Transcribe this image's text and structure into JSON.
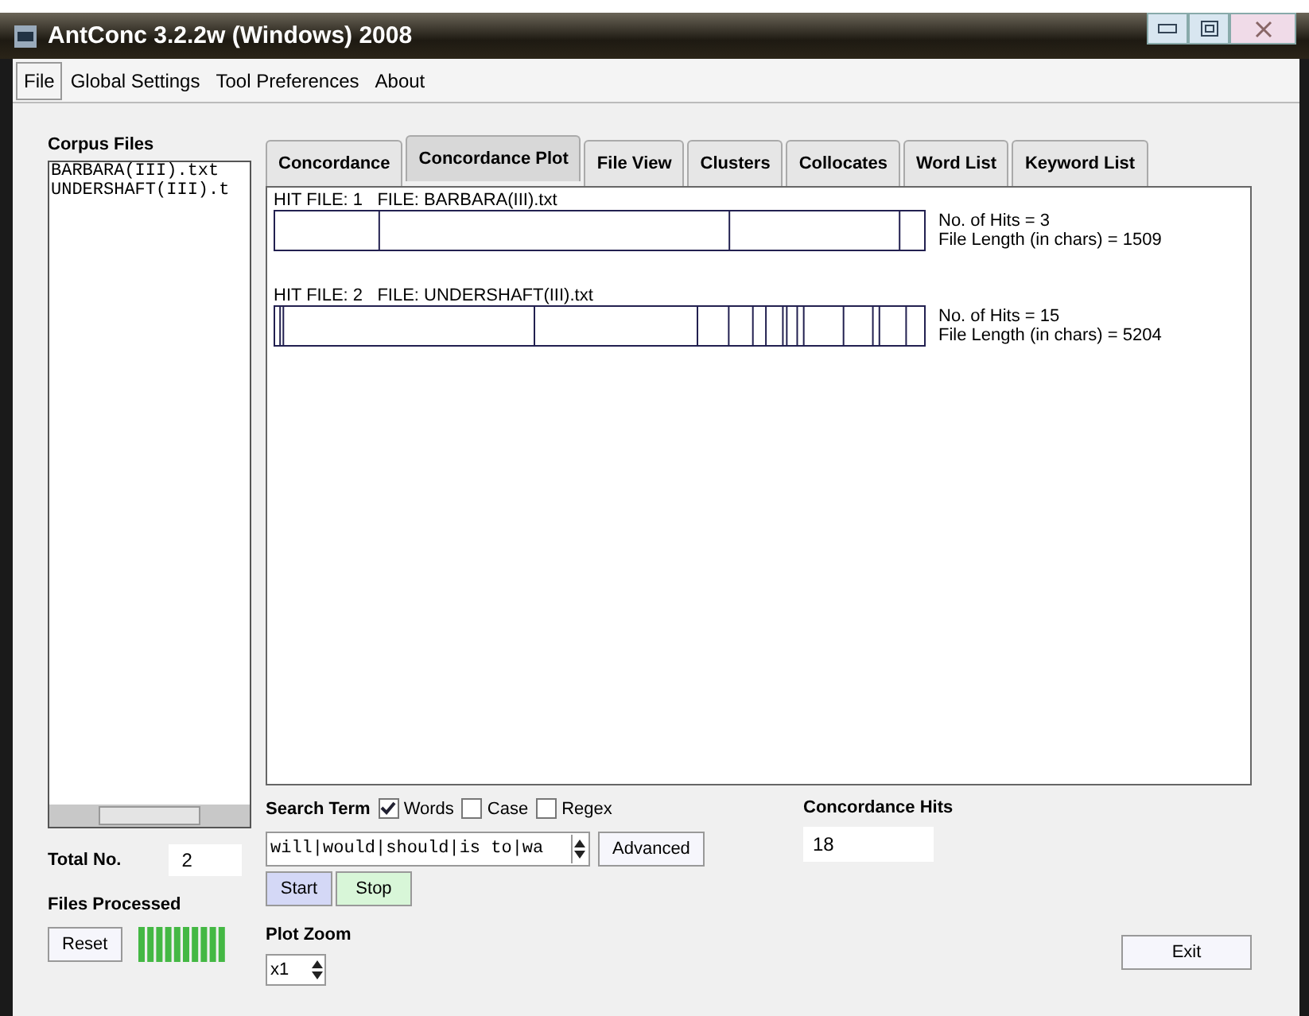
{
  "window": {
    "title": "AntConc 3.2.2w (Windows) 2008"
  },
  "menu": [
    {
      "label": "File",
      "selected": true
    },
    {
      "label": "Global Settings",
      "selected": false
    },
    {
      "label": "Tool Preferences",
      "selected": false
    },
    {
      "label": "About",
      "selected": false
    }
  ],
  "corpus": {
    "label": "Corpus Files",
    "files": [
      "BARBARA(III).txt",
      "UNDERSHAFT(III).t"
    ],
    "total_label": "Total No.",
    "total": "2",
    "processed_label": "Files Processed",
    "reset": "Reset",
    "progress": {
      "level": 1
    }
  },
  "tabs": [
    {
      "label": "Concordance",
      "selected": false
    },
    {
      "label": "Concordance Plot",
      "selected": true
    },
    {
      "label": "File View",
      "selected": false
    },
    {
      "label": "Clusters",
      "selected": false
    },
    {
      "label": "Collocates",
      "selected": false
    },
    {
      "label": "Word List",
      "selected": false
    },
    {
      "label": "Keyword List",
      "selected": false
    }
  ],
  "plots": [
    {
      "hit_file": "HIT FILE: 1",
      "file": "FILE: BARBARA(III).txt",
      "hits": "No. of Hits = 3",
      "length": "File Length (in chars) = 1509"
    },
    {
      "hit_file": "HIT FILE: 2",
      "file": "FILE: UNDERSHAFT(III).txt",
      "hits": "No. of Hits = 15",
      "length": "File Length (in chars) = 5204"
    }
  ],
  "search": {
    "label": "Search Term",
    "options": [
      {
        "label": "Words",
        "checked": true
      },
      {
        "label": "Case",
        "checked": false
      },
      {
        "label": "Regex",
        "checked": false
      }
    ],
    "value": "will|would|should|is to|wa",
    "advanced": "Advanced",
    "start": "Start",
    "stop": "Stop"
  },
  "hits": {
    "label": "Concordance Hits",
    "value": "18"
  },
  "zoom": {
    "label": "Plot Zoom",
    "value": "x1"
  },
  "exit": "Exit"
}
